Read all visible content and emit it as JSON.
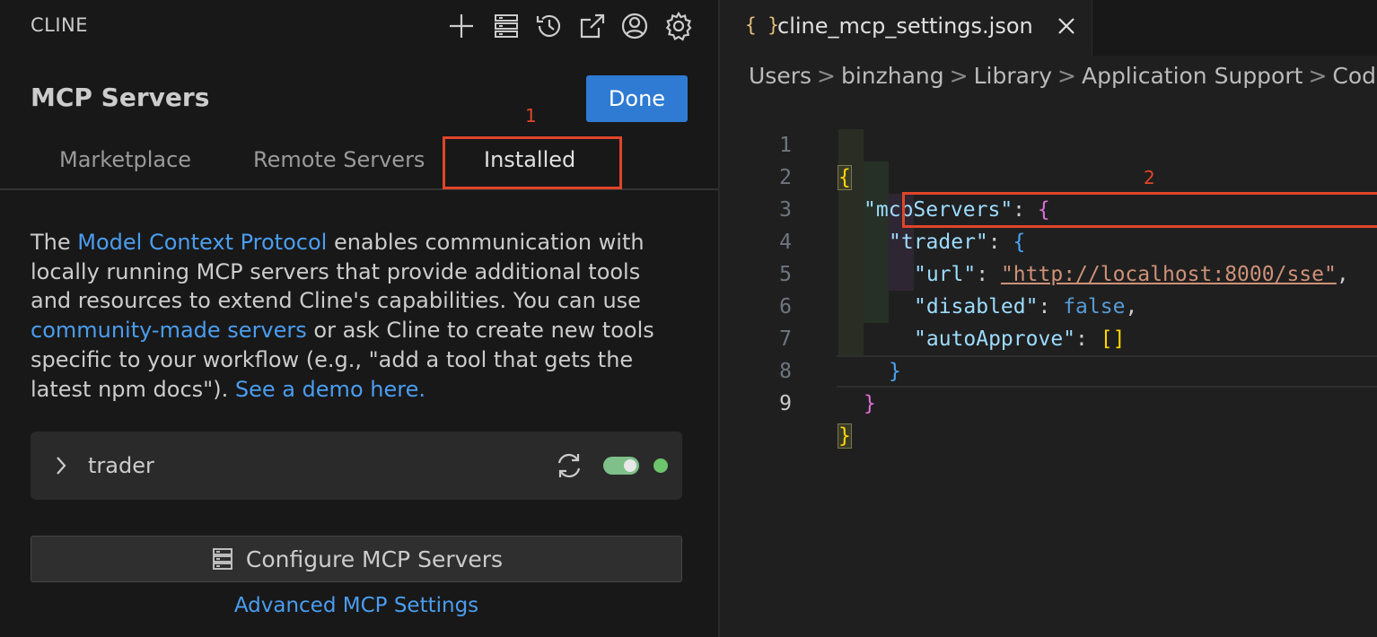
{
  "panel": {
    "app_title": "CLINE",
    "toolbar_icons": [
      "plus-icon",
      "server-list-icon",
      "history-icon",
      "popout-icon",
      "account-icon",
      "gear-icon"
    ],
    "section_title": "MCP Servers",
    "done_label": "Done",
    "tabs": [
      {
        "label": "Marketplace",
        "active": false
      },
      {
        "label": "Remote Servers",
        "active": false
      },
      {
        "label": "Installed",
        "active": true
      }
    ],
    "annotation_1": "1",
    "description": {
      "p1": "The ",
      "link1": "Model Context Protocol",
      "p2": " enables communication with locally running MCP servers that provide additional tools and resources to extend Cline's capabilities. You can use ",
      "link2": "community-made servers",
      "p3": " or ask Cline to create new tools specific to your workflow (e.g., \"add a tool that gets the latest npm docs\"). ",
      "link3": "See a demo here."
    },
    "server": {
      "name": "trader",
      "enabled": true,
      "status": "connected",
      "status_color": "#6cc46c"
    },
    "configure_label": "Configure MCP Servers",
    "advanced_label": "Advanced MCP Settings"
  },
  "editor": {
    "tab_icon": "{ }",
    "file_name": "cline_mcp_settings.json",
    "breadcrumbs": [
      "Users",
      "binzhang",
      "Library",
      "Application Support",
      "Code"
    ],
    "annotation_2": "2",
    "current_line": 9,
    "code": {
      "l1_open": "{",
      "l2_key": "\"mcpServers\"",
      "l2_colon": ": ",
      "l2_brace": "{",
      "l3_key": "\"trader\"",
      "l3_colon": ": ",
      "l3_brace": "{",
      "l4_key": "\"url\"",
      "l4_colon": ": ",
      "l4_value": "\"http://localhost:8000/sse\"",
      "l4_comma": ",",
      "l5_key": "\"disabled\"",
      "l5_colon": ": ",
      "l5_value": "false",
      "l5_comma": ",",
      "l6_key": "\"autoApprove\"",
      "l6_colon": ": ",
      "l6_value": "[]",
      "l7_close": "}",
      "l8_close": "}",
      "l9_close": "}"
    },
    "line_numbers": [
      "1",
      "2",
      "3",
      "4",
      "5",
      "6",
      "7",
      "8",
      "9"
    ]
  },
  "colors": {
    "accent_button": "#2f7bd4",
    "link": "#4a9df0",
    "annotation": "#e0452a",
    "toggle_on": "#7fbf8a"
  }
}
